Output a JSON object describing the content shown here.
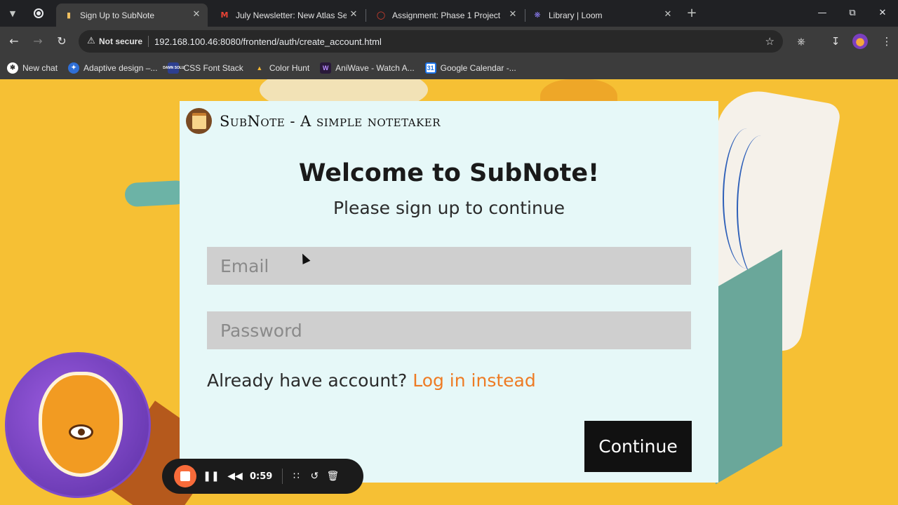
{
  "browser": {
    "tabs": [
      {
        "title": "Sign Up to SubNote",
        "active": true
      },
      {
        "title": "July Newsletter: New Atlas Search",
        "active": false
      },
      {
        "title": "Assignment: Phase 1 Project",
        "active": false
      },
      {
        "title": "Library | Loom",
        "active": false
      }
    ],
    "security_label": "Not secure",
    "url": "192.168.100.46:8080/frontend/auth/create_account.html",
    "bookmarks": [
      {
        "label": "New chat",
        "icon": "chatgpt-icon"
      },
      {
        "label": "Adaptive design –...",
        "icon": "adaptive-icon"
      },
      {
        "label": "CSS Font Stack",
        "icon": "cssfontstack-icon",
        "badge": "DAMN SOLU"
      },
      {
        "label": "Color Hunt",
        "icon": "colorhunt-icon"
      },
      {
        "label": "AniWave - Watch A...",
        "icon": "aniwave-icon",
        "badge": "W"
      },
      {
        "label": "Google Calendar -...",
        "icon": "calendar-icon",
        "badge": "31"
      }
    ]
  },
  "app": {
    "brand_title": "SubNote - A simple notetaker",
    "welcome": "Welcome to SubNote!",
    "subtitle": "Please sign up to continue",
    "email_placeholder": "Email",
    "password_placeholder": "Password",
    "already_text": "Already have account?",
    "login_link": "Log in instead",
    "continue_label": "Continue"
  },
  "recorder": {
    "time": "0:59"
  },
  "colors": {
    "page_bg": "#f6c034",
    "card_bg": "#e6f8f8",
    "link": "#ee7b24",
    "button": "#111111",
    "record": "#f86b3a"
  }
}
